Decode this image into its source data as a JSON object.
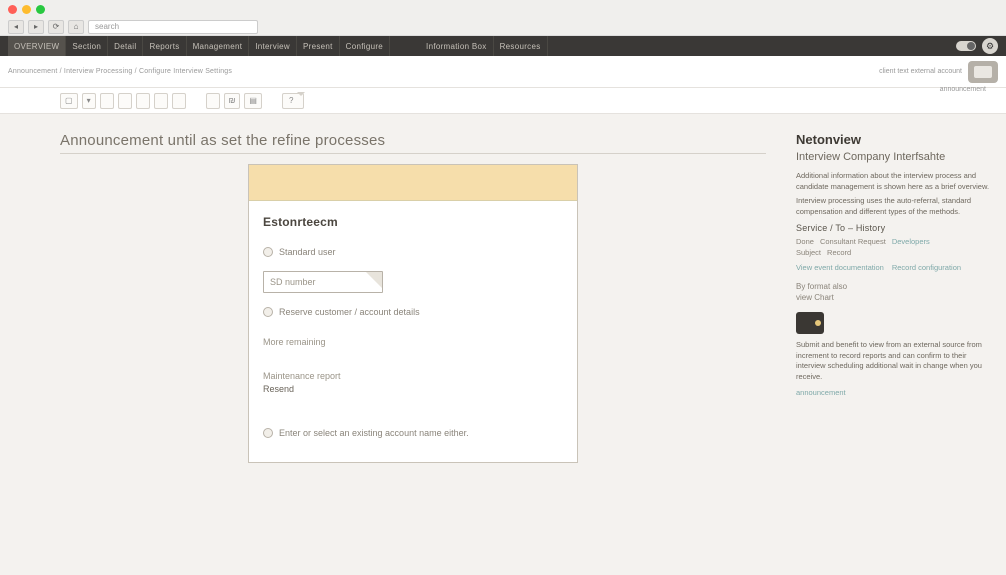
{
  "url_bar": {
    "placeholder": "search"
  },
  "menu": {
    "items": [
      "OVERVIEW",
      "Section",
      "Detail",
      "Reports",
      "Management",
      "Interview",
      "Present",
      "Configure"
    ],
    "right_items": [
      "Information Box",
      "Resources"
    ]
  },
  "breadcrumb": "Announcement / Interview Processing / Configure Interview Settings",
  "sub_right": "client text external account",
  "sub_caption": "announcement",
  "tool_row": [
    "",
    "",
    "",
    "",
    "",
    "",
    "",
    "",
    "",
    "",
    "",
    "?"
  ],
  "page": {
    "title": "Announcement until as set the refine processes"
  },
  "form": {
    "title": "Estonrteecm",
    "option1": "Standard user",
    "input_placeholder": "SD number",
    "option2": "Reserve customer / account details",
    "section2": "More remaining",
    "section3_a": "Maintenance report",
    "section3_b": "Resend",
    "footnote": "Enter or select an existing account name either."
  },
  "side": {
    "h2": "Netonview",
    "h3": "Interview Company Interfsahte",
    "p1": "Additional information about the interview process and candidate management is shown here as a brief overview.",
    "p2": "Interview processing uses the auto-referral, standard compensation and different types of the methods.",
    "sub_head": "Service / To – History",
    "meta1": [
      "Done",
      "Consultant Request"
    ],
    "meta1_link": "Developers",
    "meta2": [
      "Subject",
      "Record"
    ],
    "link_a": "View event documentation",
    "link_b": "Record configuration",
    "by_label": "By format also",
    "by_value": "view Chart",
    "p3": "Submit and benefit to view from an external source from increment to record reports and can confirm to their interview scheduling additional wait in change when you receive.",
    "footer_link": "announcement"
  }
}
